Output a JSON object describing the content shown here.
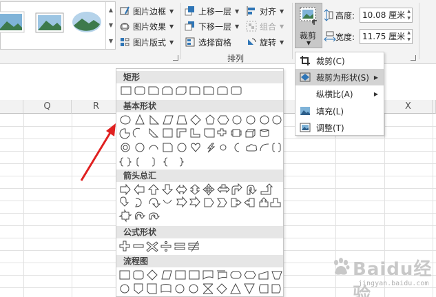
{
  "ribbon": {
    "picture_border": "图片边框",
    "picture_effects": "图片效果",
    "picture_layout": "图片版式",
    "bring_forward": "上移一层",
    "send_backward": "下移一层",
    "selection_pane": "选择窗格",
    "align": "对齐",
    "group": "组合",
    "rotate": "旋转",
    "arrange_group": "排列",
    "crop": "裁剪",
    "height_label": "高度:",
    "height_value": "10.08 厘米",
    "width_label": "宽度:",
    "width_value": "11.75 厘米"
  },
  "sheet": {
    "columns": [
      "Q",
      "R",
      "X"
    ]
  },
  "shapes_panel": {
    "categories": [
      "矩形",
      "基本形状",
      "箭头总汇",
      "公式形状",
      "流程图"
    ]
  },
  "crop_menu": {
    "items": [
      "裁剪(C)",
      "裁剪为形状(S)",
      "纵横比(A)",
      "填充(L)",
      "调整(T)"
    ],
    "highlighted": "裁剪为形状(S)"
  },
  "watermark": {
    "main": "Baidu经验",
    "sub": "jingyan.baidu.com"
  },
  "colors": {
    "arrow": "#e02020",
    "highlight": "#d3d3d3",
    "icon_blue": "#2e75b6"
  }
}
